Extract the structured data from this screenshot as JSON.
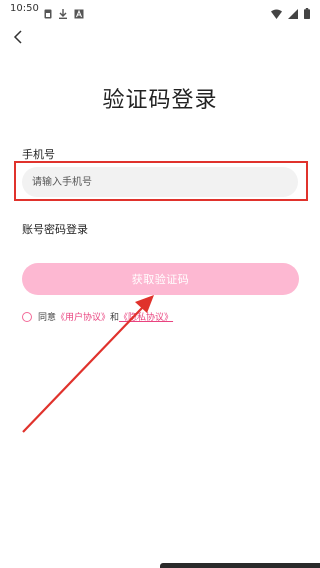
{
  "status_bar": {
    "time": "10:50",
    "left_icons": [
      "sim-card-icon",
      "download-icon",
      "app-a-icon"
    ],
    "right_icons": [
      "wifi-icon",
      "signal-icon",
      "battery-icon"
    ]
  },
  "header": {
    "back_icon": "chevron-left-icon"
  },
  "title": "验证码登录",
  "phone": {
    "label": "手机号",
    "placeholder": "请输入手机号"
  },
  "password_login": "账号密码登录",
  "get_code_button": "获取验证码",
  "agreement": {
    "prefix": "同意",
    "user_agreement": "《用户协议》",
    "and": "和",
    "privacy_agreement": "《隐私协议》"
  },
  "colors": {
    "accent": "#fdb8d2",
    "link": "#e9437f",
    "highlight": "#e0322c",
    "annotation_arrow": "#e0322c"
  }
}
